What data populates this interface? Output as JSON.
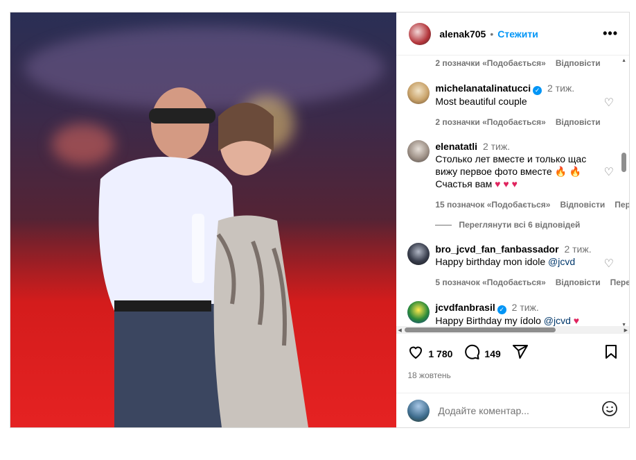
{
  "header": {
    "username": "alenak705",
    "separator": "•",
    "follow_label": "Стежити",
    "more_label": "•••"
  },
  "comments": {
    "top_meta": {
      "likes": "2 позначки «Подобається»",
      "reply": "Відповісти"
    },
    "items": [
      {
        "username": "michelanatalinatucci",
        "verified": true,
        "time": "2 тиж.",
        "text": "Most beautiful couple",
        "likes": "2 позначки «Подобається»",
        "reply": "Відповісти"
      },
      {
        "username": "elenatatli",
        "verified": false,
        "time": "2 тиж.",
        "lines": [
          "Столько лет вместе и только щас",
          "вижу первое фото вместе",
          "Счастья вам"
        ],
        "emoji_fire": "🔥 🔥",
        "emoji_hearts": "♥ ♥ ♥",
        "likes": "15 позначок «Подобається»",
        "reply": "Відповісти",
        "translate": "Пере"
      },
      {
        "username": "bro_jcvd_fan_fanbassador",
        "verified": false,
        "time": "2 тиж.",
        "text": "Happy birthday mon idole",
        "mention": "@jcvd",
        "likes": "5 позначок «Подобається»",
        "reply": "Відповісти",
        "translate": "Пере"
      },
      {
        "username": "jcvdfanbrasil",
        "verified": true,
        "time": "2 тиж.",
        "text": "Happy Birthday my ídolo",
        "mention": "@jcvd",
        "emoji_heart": "♥"
      }
    ],
    "view_replies": "Переглянути всі 6 відповідей"
  },
  "actions": {
    "likes_count": "1 780",
    "comments_count": "149",
    "date": "18 жовтень"
  },
  "composer": {
    "placeholder": "Додайте коментар..."
  },
  "icons": {
    "like": "heart-icon",
    "comment": "comment-icon",
    "share": "share-icon",
    "save": "bookmark-icon",
    "emoji": "emoji-icon"
  }
}
